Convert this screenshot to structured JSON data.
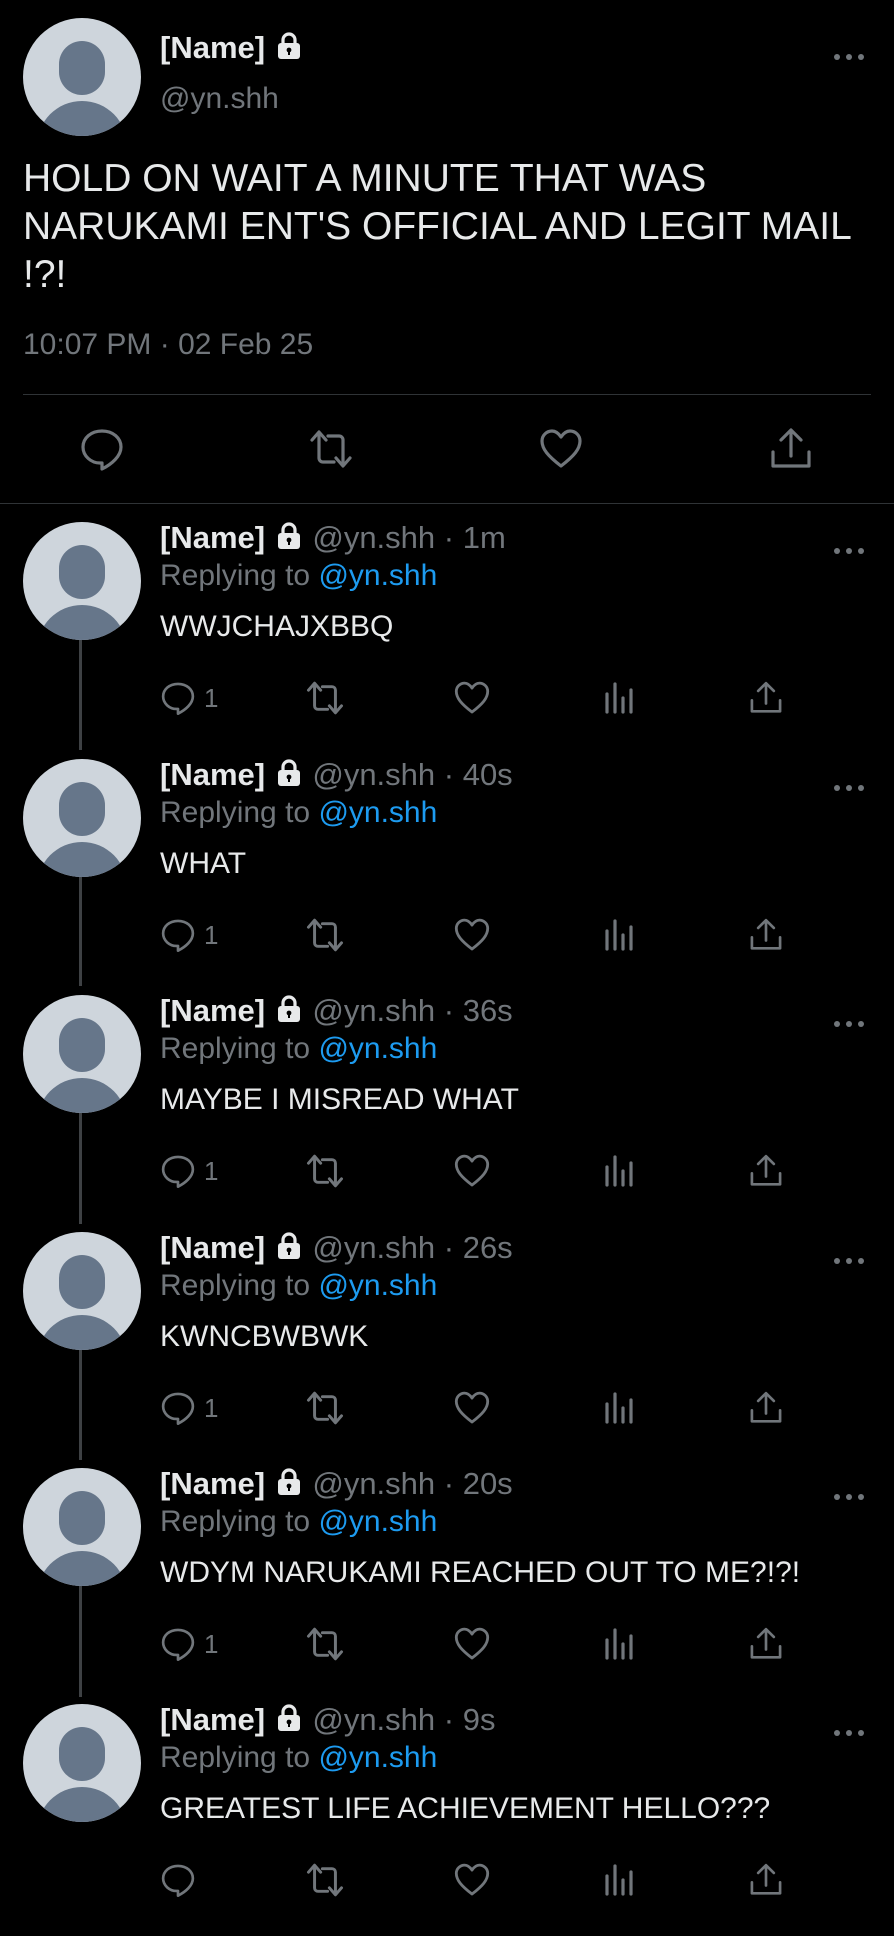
{
  "colors": {
    "background": "#000000",
    "text": "#e7e9ea",
    "muted": "#71767b",
    "link": "#1d9bf0",
    "divider": "#2f3336"
  },
  "main_tweet": {
    "name": "[Name]",
    "handle": "@yn.shh",
    "text": "HOLD ON WAIT A MINUTE THAT WAS NARUKAMI ENT'S OFFICIAL AND LEGIT MAIL !?!",
    "timestamp": "10:07 PM · 02 Feb 25",
    "icons": [
      "lock-icon",
      "more-icon",
      "reply-icon",
      "retweet-icon",
      "like-icon",
      "share-icon"
    ]
  },
  "replies": [
    {
      "name": "[Name]",
      "meta": "@yn.shh · 1m",
      "replying_label": "Replying to",
      "replying_to": "@yn.shh",
      "text": "WWJCHAJXBBQ",
      "reply_count": "1"
    },
    {
      "name": "[Name]",
      "meta": "@yn.shh · 40s",
      "replying_label": "Replying to",
      "replying_to": "@yn.shh",
      "text": "WHAT",
      "reply_count": "1"
    },
    {
      "name": "[Name]",
      "meta": "@yn.shh · 36s",
      "replying_label": "Replying to",
      "replying_to": "@yn.shh",
      "text": "MAYBE I MISREAD WHAT",
      "reply_count": "1"
    },
    {
      "name": "[Name]",
      "meta": "@yn.shh · 26s",
      "replying_label": "Replying to",
      "replying_to": "@yn.shh",
      "text": "KWNCBWBWK",
      "reply_count": "1"
    },
    {
      "name": "[Name]",
      "meta": "@yn.shh · 20s",
      "replying_label": "Replying to",
      "replying_to": "@yn.shh",
      "text": "WDYM NARUKAMI REACHED OUT TO ME?!?!",
      "reply_count": "1"
    },
    {
      "name": "[Name]",
      "meta": "@yn.shh · 9s",
      "replying_label": "Replying to",
      "replying_to": "@yn.shh",
      "text": "GREATEST LIFE ACHIEVEMENT HELLO???",
      "reply_count": ""
    }
  ],
  "reply_icons": [
    "reply-icon",
    "retweet-icon",
    "like-icon",
    "analytics-icon",
    "share-icon"
  ]
}
